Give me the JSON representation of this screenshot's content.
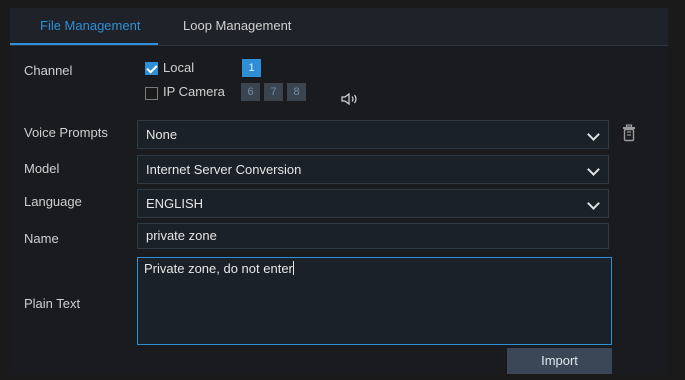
{
  "tabs": [
    {
      "label": "File Management",
      "active": true
    },
    {
      "label": "Loop Management",
      "active": false
    }
  ],
  "channel": {
    "label": "Channel",
    "local": {
      "label": "Local",
      "checked": true,
      "channels": [
        "1"
      ]
    },
    "ip_camera": {
      "label": "IP Camera",
      "checked": false,
      "channels": [
        "6",
        "7",
        "8"
      ]
    },
    "speaker_icon": "speaker-icon"
  },
  "voice_prompts": {
    "label": "Voice Prompts",
    "value": "None",
    "delete_icon": "trash-icon"
  },
  "model": {
    "label": "Model",
    "value": "Internet Server Conversion"
  },
  "language": {
    "label": "Language",
    "value": "ENGLISH"
  },
  "name": {
    "label": "Name",
    "value": "private zone"
  },
  "plain_text": {
    "label": "Plain Text",
    "value": "Private zone, do not enter"
  },
  "import_button": {
    "label": "Import"
  },
  "colors": {
    "accent": "#2e8fd6",
    "background": "#1a1a1a",
    "field": "#1a2128"
  }
}
